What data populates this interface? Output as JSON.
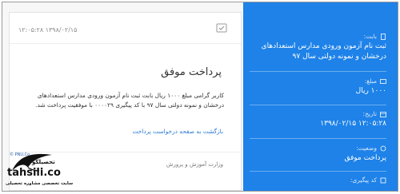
{
  "receipt": {
    "date": "۱۲:۰۵:۲۸ ۱۳۹۸/۰۲/۱۵",
    "title": "پرداخت موفق",
    "message": "کاربر گرامی مبلغ ۱۰۰۰ ریال بابت ثبت نام آزمون ورودی مدارس استعدادهای درخشان و نمونه دولتی سال ۹۷ با کد پیگیری ۰۰۰۰۲۹ با موفقیت پرداخت شد.",
    "back_link": "بازگشت به صفحه درخواست پرداخت",
    "footer": "وزارت آموزش و پرورش"
  },
  "details": {
    "fields": [
      {
        "label": "بابت:",
        "value": "ثبت نام آزمون ورودی مدارس استعدادهای درخشان و نمونه دولتی سال ۹۷",
        "icon": "document-icon"
      },
      {
        "label": "مبلغ:",
        "value": "۱۰۰۰ ریال",
        "icon": "wallet-icon"
      },
      {
        "label": "تاریخ:",
        "value": "۱۲:۰۵:۲۸ ۱۳۹۸/۰۲/۱۵",
        "icon": "calendar-icon"
      },
      {
        "label": "وضعیت:",
        "value": "پرداخت موفق",
        "icon": "status-icon"
      },
      {
        "label": "کد پیگیری:",
        "value": "",
        "icon": "code-icon"
      }
    ]
  },
  "watermark": {
    "small": "© PNU.Co",
    "brand_fa": "تحصیلکو",
    "brand": "tahsili.co",
    "tagline": "سایت تخصصی مشاوره تحصیلی"
  },
  "colors": {
    "panel": "#1e82e8",
    "link": "#2a7bd6"
  }
}
